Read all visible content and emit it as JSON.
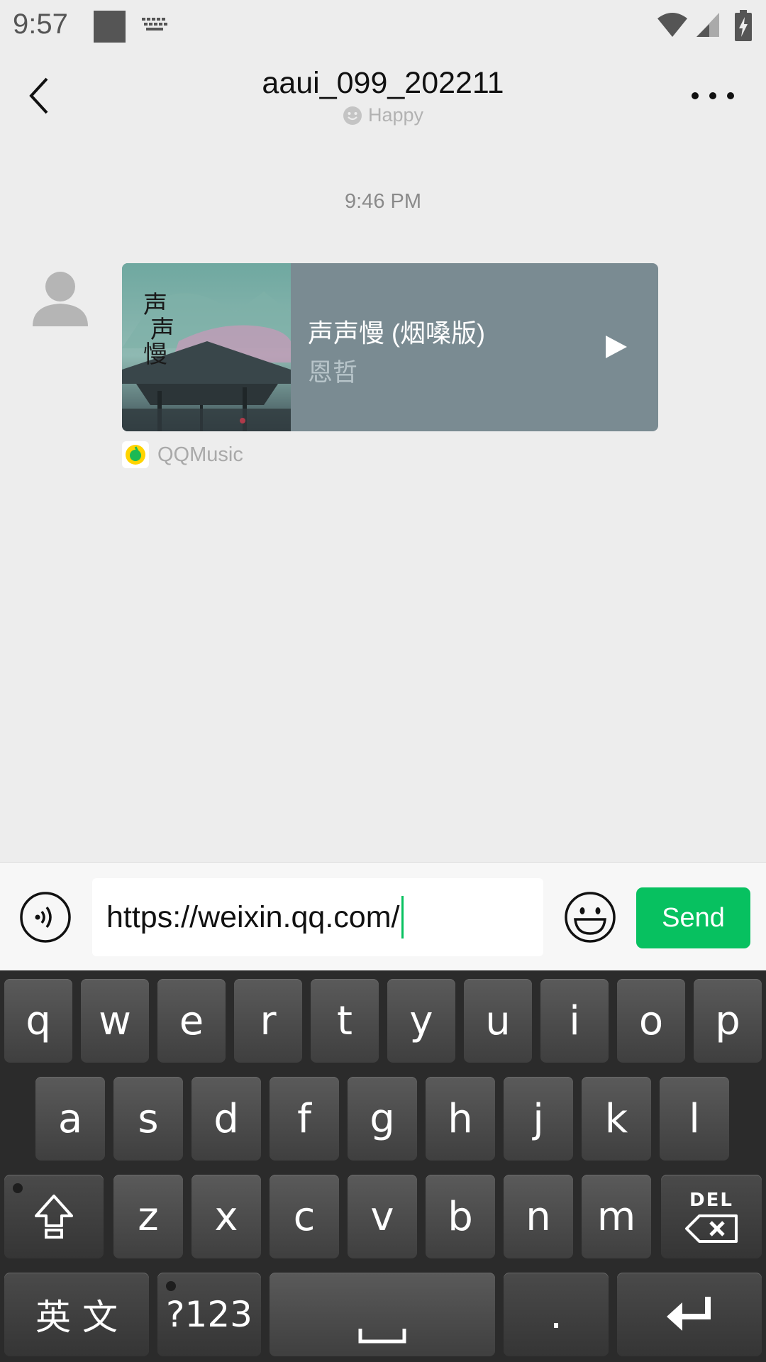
{
  "status_bar": {
    "time": "9:57"
  },
  "header": {
    "title": "aaui_099_202211",
    "status": "Happy"
  },
  "chat": {
    "timestamp": "9:46 PM",
    "music_card": {
      "title": "声声慢 (烟嗓版)",
      "artist": "恩哲",
      "source": "QQMusic"
    }
  },
  "input": {
    "value": "https://weixin.qq.com/",
    "send_label": "Send"
  },
  "keyboard": {
    "row1": [
      "q",
      "w",
      "e",
      "r",
      "t",
      "y",
      "u",
      "i",
      "o",
      "p"
    ],
    "row2": [
      "a",
      "s",
      "d",
      "f",
      "g",
      "h",
      "j",
      "k",
      "l"
    ],
    "row3": [
      "z",
      "x",
      "c",
      "v",
      "b",
      "n",
      "m"
    ],
    "del_label": "DEL",
    "lang_label": "英 文",
    "symbols_label": "?123",
    "period_label": "."
  },
  "colors": {
    "accent": "#07c160",
    "background": "#ededed",
    "music_card_bg": "#7a8b92"
  }
}
